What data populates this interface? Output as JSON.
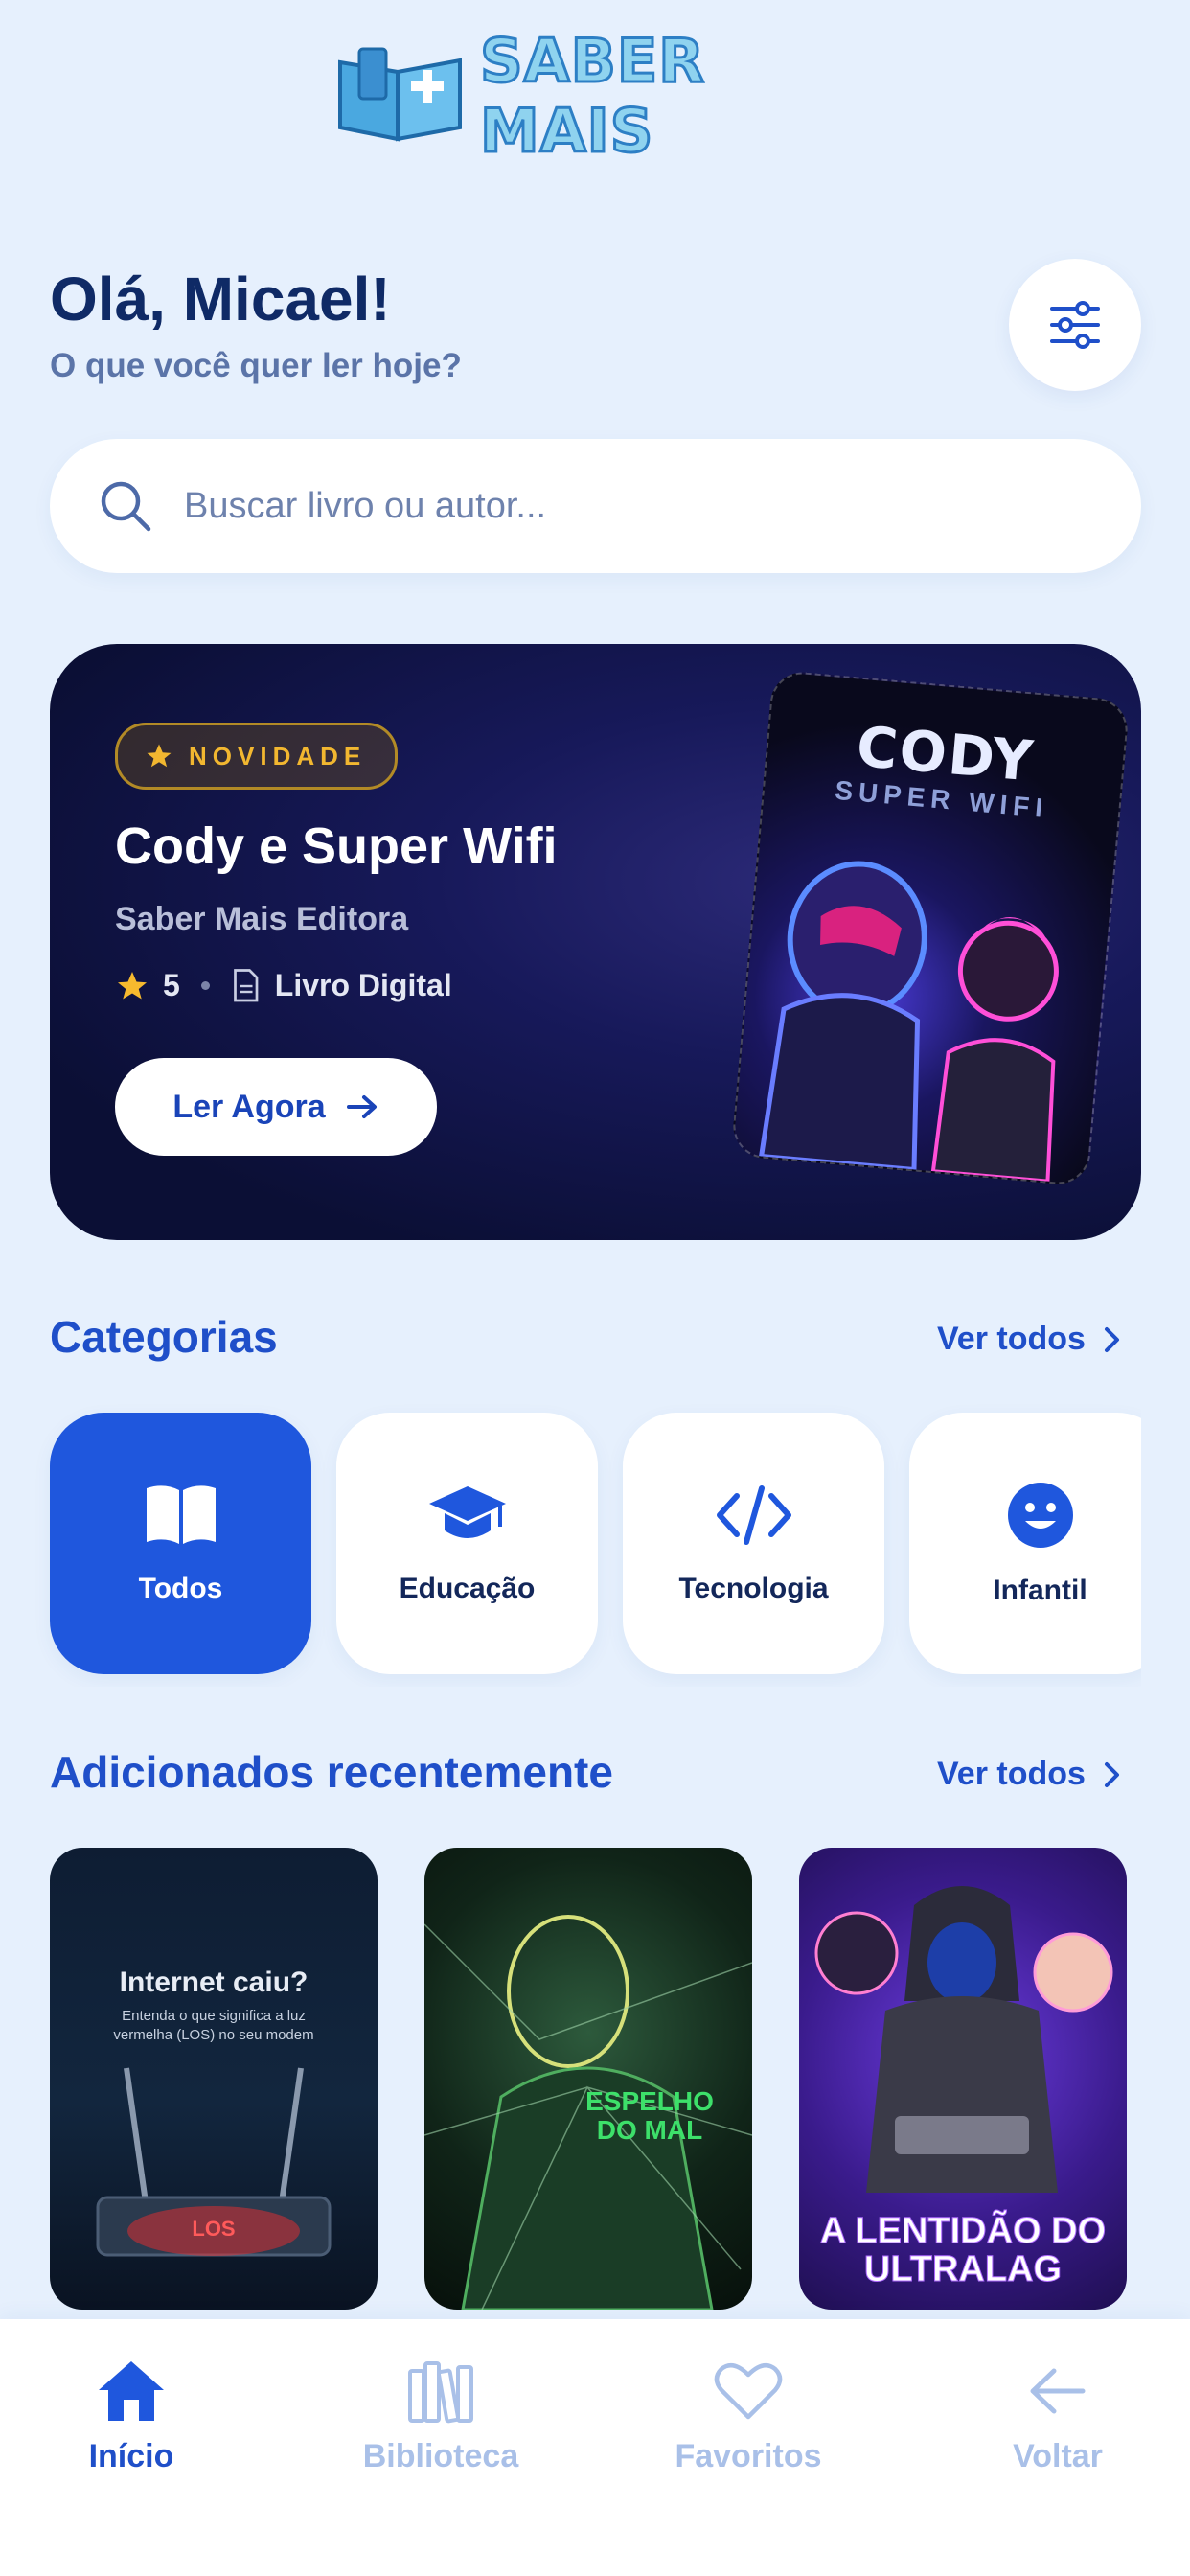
{
  "app": {
    "brand": "SABER MAIS"
  },
  "greeting": {
    "title": "Olá, Micael!",
    "subtitle": "O que você quer ler hoje?"
  },
  "search": {
    "placeholder": "Buscar livro ou autor..."
  },
  "featured": {
    "badge": "NOVIDADE",
    "title": "Cody e Super Wifi",
    "publisher": "Saber Mais Editora",
    "rating": "5",
    "format": "Livro Digital",
    "cta": "Ler Agora",
    "cover_title": "CODY",
    "cover_subtitle": "SUPER WIFI"
  },
  "categories": {
    "title": "Categorias",
    "see_all": "Ver todos",
    "items": [
      {
        "label": "Todos",
        "icon": "book-open-icon",
        "active": true
      },
      {
        "label": "Educação",
        "icon": "graduation-cap-icon",
        "active": false
      },
      {
        "label": "Tecnologia",
        "icon": "code-icon",
        "active": false
      },
      {
        "label": "Infantil",
        "icon": "smiley-icon",
        "active": false
      }
    ]
  },
  "recent": {
    "title": "Adicionados recentemente",
    "see_all": "Ver todos",
    "books": [
      {
        "title": "Internet caiu?",
        "subtitle": "Entenda o que significa a luz vermelha (LOS) no seu modem",
        "tag": "LOS"
      },
      {
        "title": "ESPELHO DO MAL"
      },
      {
        "title": "A LENTIDÃO DO ULTRALAG"
      }
    ]
  },
  "nav": {
    "items": [
      {
        "label": "Início",
        "icon": "home-icon",
        "active": true
      },
      {
        "label": "Biblioteca",
        "icon": "library-icon",
        "active": false
      },
      {
        "label": "Favoritos",
        "icon": "heart-icon",
        "active": false
      },
      {
        "label": "Voltar",
        "icon": "arrow-left-icon",
        "active": false
      }
    ]
  },
  "colors": {
    "primary": "#1f57dd",
    "background": "#e6f0fd",
    "gold": "#f2b730",
    "banner": "#0b0f35"
  }
}
